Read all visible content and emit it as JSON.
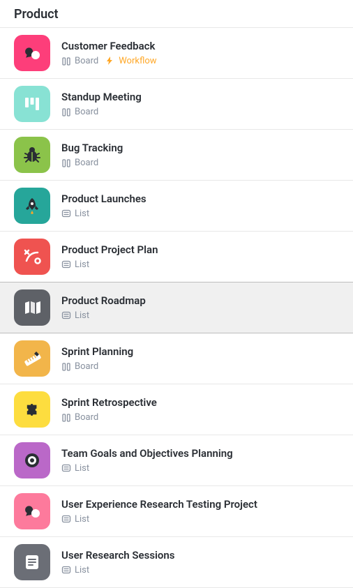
{
  "section": {
    "title": "Product"
  },
  "view_labels": {
    "board": "Board",
    "list": "List",
    "workflow": "Workflow"
  },
  "colors": {
    "pink": "#fd3e7a",
    "teal": "#88e2d4",
    "green": "#8bc34a",
    "darkteal": "#26a69a",
    "red": "#ef5350",
    "gray": "#5e6167",
    "orange": "#f2b54a",
    "yellow": "#fddd3f",
    "purple": "#ba68c8",
    "pink2": "#fd7a9c",
    "darkgray": "#6b6e76"
  },
  "items": [
    {
      "title": "Customer Feedback",
      "icon": "chat-icon",
      "color": "pink",
      "views": [
        "board",
        "workflow"
      ],
      "selected": false
    },
    {
      "title": "Standup Meeting",
      "icon": "kanban-icon",
      "color": "teal",
      "views": [
        "board"
      ],
      "selected": false
    },
    {
      "title": "Bug Tracking",
      "icon": "bug-icon",
      "color": "green",
      "views": [
        "board"
      ],
      "selected": false
    },
    {
      "title": "Product Launches",
      "icon": "rocket-icon",
      "color": "darkteal",
      "views": [
        "list"
      ],
      "selected": false
    },
    {
      "title": "Product Project Plan",
      "icon": "strategy-icon",
      "color": "red",
      "views": [
        "list"
      ],
      "selected": false
    },
    {
      "title": "Product Roadmap",
      "icon": "map-icon",
      "color": "gray",
      "views": [
        "list"
      ],
      "selected": true
    },
    {
      "title": "Sprint Planning",
      "icon": "ruler-icon",
      "color": "orange",
      "views": [
        "board"
      ],
      "selected": false
    },
    {
      "title": "Sprint Retrospective",
      "icon": "puzzle-icon",
      "color": "yellow",
      "views": [
        "board"
      ],
      "selected": false
    },
    {
      "title": "Team Goals and Objectives Planning",
      "icon": "target-icon",
      "color": "purple",
      "views": [
        "list"
      ],
      "selected": false
    },
    {
      "title": "User Experience Research Testing Project",
      "icon": "chat-icon",
      "color": "pink2",
      "views": [
        "list"
      ],
      "selected": false
    },
    {
      "title": "User Research Sessions",
      "icon": "notes-icon",
      "color": "darkgray",
      "views": [
        "list"
      ],
      "selected": false
    }
  ]
}
